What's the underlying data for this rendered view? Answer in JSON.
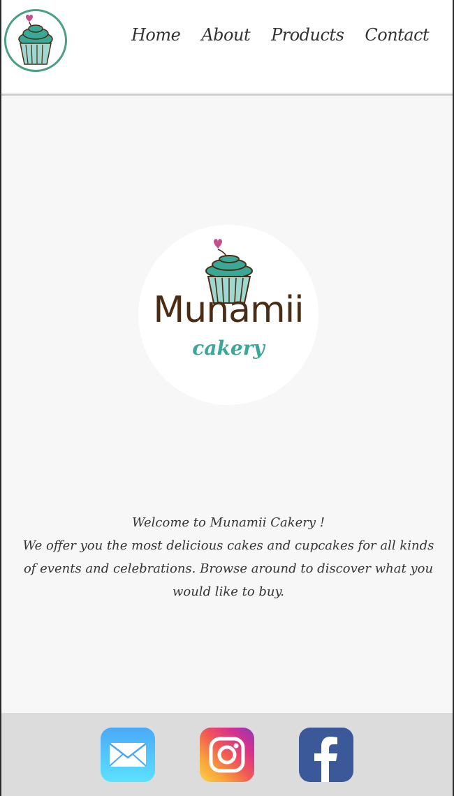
{
  "header": {
    "logo_icon": "cupcake-logo-icon",
    "nav": [
      {
        "label": "Home"
      },
      {
        "label": "About"
      },
      {
        "label": "Products"
      },
      {
        "label": "Contact"
      }
    ]
  },
  "hero": {
    "brand_name": "Munamii",
    "brand_sub": "cakery"
  },
  "intro": {
    "line1": "Welcome to Munamii Cakery !",
    "body": "We offer you the most delicious cakes and cupcakes for all kinds of events and celebrations. Browse around to discover what you would like to buy."
  },
  "footer": {
    "icons": [
      "mail-icon",
      "instagram-icon",
      "facebook-icon"
    ]
  },
  "colors": {
    "accent": "#4a9f86",
    "brand_brown": "#4a2c14",
    "brand_teal": "#3aa897",
    "heart": "#c24f8e"
  }
}
